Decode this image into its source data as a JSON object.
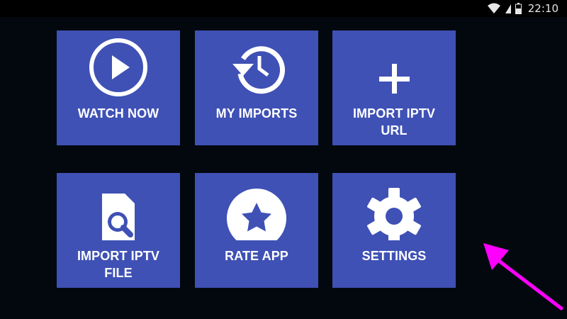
{
  "status_bar": {
    "time": "22:10",
    "icons": [
      "wifi-icon",
      "signal-icon",
      "battery-icon"
    ]
  },
  "tiles": [
    {
      "label": "WATCH NOW",
      "icon": "play-circle-icon"
    },
    {
      "label": "MY IMPORTS",
      "icon": "history-icon"
    },
    {
      "label": "IMPORT IPTV\nURL",
      "icon": "plus-icon"
    },
    {
      "label": "IMPORT IPTV\nFILE",
      "icon": "file-search-icon"
    },
    {
      "label": "RATE APP",
      "icon": "star-circle-icon"
    },
    {
      "label": "SETTINGS",
      "icon": "gear-icon"
    }
  ],
  "colors": {
    "background": "#03080f",
    "tile": "#3f51b5",
    "tile_text": "#ffffff",
    "annotation_arrow": "#ff00ff"
  }
}
